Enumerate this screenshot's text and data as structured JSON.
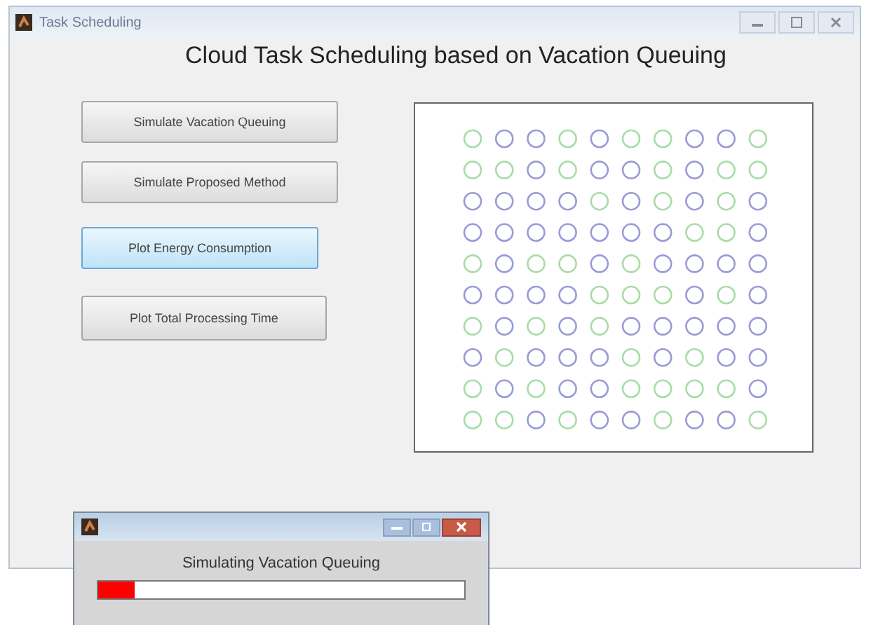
{
  "window": {
    "title": "Task Scheduling"
  },
  "heading": "Cloud Task Scheduling based on Vacation Queuing",
  "buttons": [
    {
      "label": "Simulate Vacation Queuing",
      "highlighted": false
    },
    {
      "label": "Simulate Proposed Method",
      "highlighted": false
    },
    {
      "label": "Plot Energy Consumption",
      "highlighted": true
    },
    {
      "label": "Plot Total Processing Time",
      "highlighted": false
    }
  ],
  "grid": [
    {
      "cells": [
        {
          "color": "#a8dca8"
        },
        {
          "color": "#9a9ad8"
        },
        {
          "color": "#9a9ad8"
        },
        {
          "color": "#a8dca8"
        },
        {
          "color": "#9a9ad8"
        },
        {
          "color": "#a8dca8"
        },
        {
          "color": "#a8dca8"
        },
        {
          "color": "#9a9ad8"
        },
        {
          "color": "#9a9ad8"
        },
        {
          "color": "#a8dca8"
        }
      ]
    },
    {
      "cells": [
        {
          "color": "#a8dca8"
        },
        {
          "color": "#a8dca8"
        },
        {
          "color": "#9a9ad8"
        },
        {
          "color": "#a8dca8"
        },
        {
          "color": "#9a9ad8"
        },
        {
          "color": "#9a9ad8"
        },
        {
          "color": "#a8dca8"
        },
        {
          "color": "#9a9ad8"
        },
        {
          "color": "#a8dca8"
        },
        {
          "color": "#a8dca8"
        }
      ]
    },
    {
      "cells": [
        {
          "color": "#9a9ad8"
        },
        {
          "color": "#9a9ad8"
        },
        {
          "color": "#9a9ad8"
        },
        {
          "color": "#9a9ad8"
        },
        {
          "color": "#a8dca8"
        },
        {
          "color": "#9a9ad8"
        },
        {
          "color": "#a8dca8"
        },
        {
          "color": "#9a9ad8"
        },
        {
          "color": "#a8dca8"
        },
        {
          "color": "#9a9ad8"
        }
      ]
    },
    {
      "cells": [
        {
          "color": "#9a9ad8"
        },
        {
          "color": "#9a9ad8"
        },
        {
          "color": "#9a9ad8"
        },
        {
          "color": "#9a9ad8"
        },
        {
          "color": "#9a9ad8"
        },
        {
          "color": "#9a9ad8"
        },
        {
          "color": "#9a9ad8"
        },
        {
          "color": "#a8dca8"
        },
        {
          "color": "#a8dca8"
        },
        {
          "color": "#9a9ad8"
        }
      ]
    },
    {
      "cells": [
        {
          "color": "#a8dca8"
        },
        {
          "color": "#9a9ad8"
        },
        {
          "color": "#a8dca8"
        },
        {
          "color": "#a8dca8"
        },
        {
          "color": "#9a9ad8"
        },
        {
          "color": "#a8dca8"
        },
        {
          "color": "#9a9ad8"
        },
        {
          "color": "#9a9ad8"
        },
        {
          "color": "#9a9ad8"
        },
        {
          "color": "#9a9ad8"
        }
      ]
    },
    {
      "cells": [
        {
          "color": "#9a9ad8"
        },
        {
          "color": "#9a9ad8"
        },
        {
          "color": "#9a9ad8"
        },
        {
          "color": "#9a9ad8"
        },
        {
          "color": "#a8dca8"
        },
        {
          "color": "#a8dca8"
        },
        {
          "color": "#a8dca8"
        },
        {
          "color": "#9a9ad8"
        },
        {
          "color": "#a8dca8"
        },
        {
          "color": "#9a9ad8"
        }
      ]
    },
    {
      "cells": [
        {
          "color": "#a8dca8"
        },
        {
          "color": "#9a9ad8"
        },
        {
          "color": "#a8dca8"
        },
        {
          "color": "#9a9ad8"
        },
        {
          "color": "#a8dca8"
        },
        {
          "color": "#9a9ad8"
        },
        {
          "color": "#9a9ad8"
        },
        {
          "color": "#9a9ad8"
        },
        {
          "color": "#9a9ad8"
        },
        {
          "color": "#9a9ad8"
        }
      ]
    },
    {
      "cells": [
        {
          "color": "#9a9ad8"
        },
        {
          "color": "#a8dca8"
        },
        {
          "color": "#9a9ad8"
        },
        {
          "color": "#9a9ad8"
        },
        {
          "color": "#9a9ad8"
        },
        {
          "color": "#a8dca8"
        },
        {
          "color": "#9a9ad8"
        },
        {
          "color": "#a8dca8"
        },
        {
          "color": "#9a9ad8"
        },
        {
          "color": "#9a9ad8"
        }
      ]
    },
    {
      "cells": [
        {
          "color": "#a8dca8"
        },
        {
          "color": "#9a9ad8"
        },
        {
          "color": "#a8dca8"
        },
        {
          "color": "#9a9ad8"
        },
        {
          "color": "#9a9ad8"
        },
        {
          "color": "#a8dca8"
        },
        {
          "color": "#a8dca8"
        },
        {
          "color": "#a8dca8"
        },
        {
          "color": "#a8dca8"
        },
        {
          "color": "#9a9ad8"
        }
      ]
    },
    {
      "cells": [
        {
          "color": "#a8dca8"
        },
        {
          "color": "#a8dca8"
        },
        {
          "color": "#9a9ad8"
        },
        {
          "color": "#a8dca8"
        },
        {
          "color": "#9a9ad8"
        },
        {
          "color": "#9a9ad8"
        },
        {
          "color": "#a8dca8"
        },
        {
          "color": "#9a9ad8"
        },
        {
          "color": "#9a9ad8"
        },
        {
          "color": "#a8dca8"
        }
      ]
    }
  ],
  "progress_dialog": {
    "message": "Simulating Vacation Queuing",
    "level": 0.1
  }
}
